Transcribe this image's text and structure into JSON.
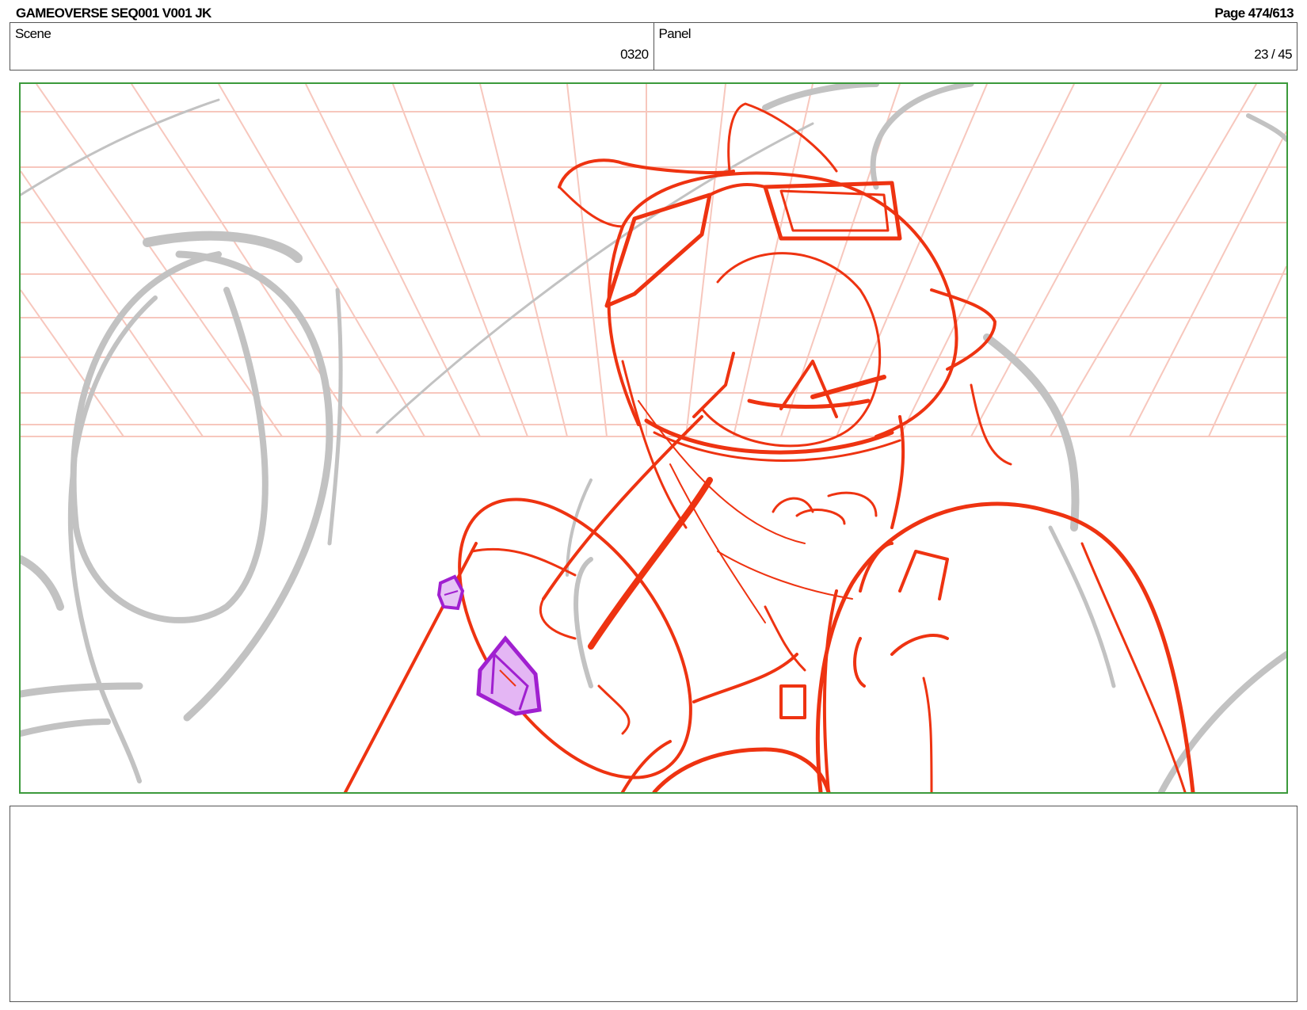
{
  "header": {
    "title": "GAMEOVERSE SEQ001 V001 JK",
    "page": "Page 474/613"
  },
  "info": {
    "scene_label": "Scene",
    "scene_value": "0320",
    "panel_label": "Panel",
    "panel_value": "23 / 45"
  },
  "colors": {
    "frame_border": "#3c9a3c",
    "sketch_red": "#ee3311",
    "grid_pink": "#f7c7bd",
    "background_gray": "#c2c2c2",
    "gem_purple": "#a020d0"
  },
  "notes": {
    "text": ""
  }
}
